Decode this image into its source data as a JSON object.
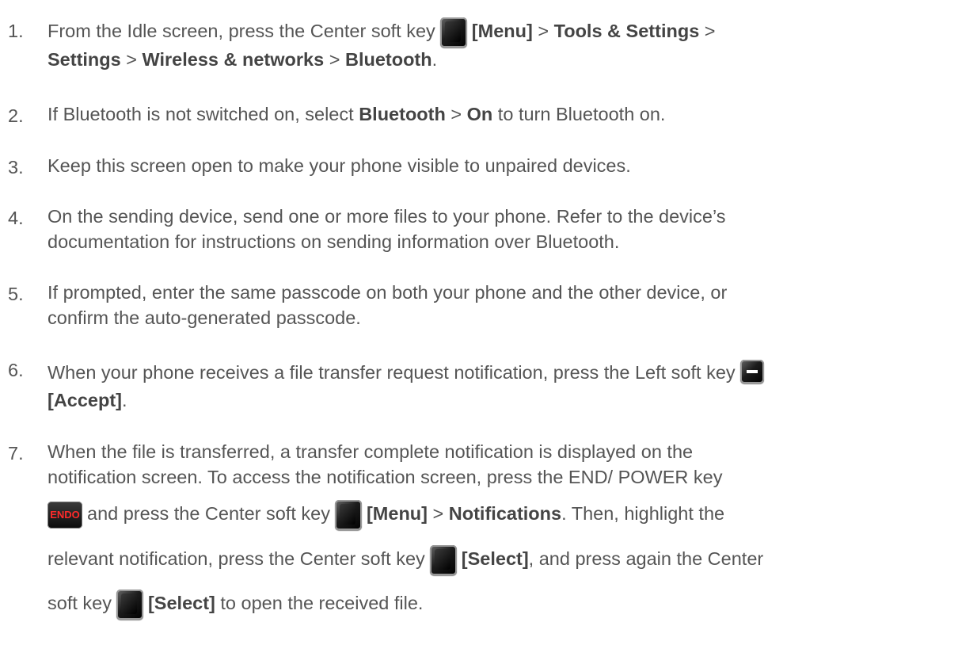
{
  "steps": [
    {
      "num": "1.",
      "lines": [
        {
          "pre": "From the Idle screen, press the Center soft key",
          "b1": "[Menu]",
          "s1": " > ",
          "b2": "Tools & Settings",
          "s2": " >"
        },
        {
          "b1": "Settings",
          "s1": " > ",
          "b2": "Wireless & networks",
          "s2": " > ",
          "b3": "Bluetooth",
          "post": "."
        }
      ]
    },
    {
      "num": "2.",
      "lines": [
        {
          "pre": "If Bluetooth is not switched on, select ",
          "b1": "Bluetooth",
          "s1": " > ",
          "b2": "On",
          "post": " to turn Bluetooth on."
        }
      ]
    },
    {
      "num": "3.",
      "lines": [
        {
          "text": "Keep this screen open to make your phone visible to unpaired devices."
        }
      ]
    },
    {
      "num": "4.",
      "lines": [
        {
          "text": "On the sending device, send one or more files to your phone. Refer to the device’s"
        },
        {
          "text": "documentation for instructions on sending information over Bluetooth."
        }
      ]
    },
    {
      "num": "5.",
      "lines": [
        {
          "text": "If prompted, enter the same passcode on both your phone and the other device, or"
        },
        {
          "text": "confirm the auto-generated passcode."
        }
      ]
    },
    {
      "num": "6.",
      "lines": [
        {
          "text": "When your phone receives a file transfer request notification, press the Left soft key"
        },
        {
          "b1": "[Accept]",
          "post": "."
        }
      ]
    },
    {
      "num": "7.",
      "lines": [
        {
          "text": "When the file is transferred, a transfer complete notification is displayed on the"
        },
        {
          "text": "notification screen. To access the notification screen, press the END/ POWER key"
        },
        {
          "pre": "and press the Center soft key",
          "b1": "[Menu]",
          "s1": " > ",
          "b2": "Notifications",
          "post": ". Then, highlight the"
        },
        {
          "pre": "relevant notification, press the Center soft key",
          "b1": "[Select]",
          "post": ", and press again the Center"
        },
        {
          "pre": "soft key",
          "b1": "[Select]",
          "post": " to open the received file."
        }
      ]
    }
  ],
  "icons": {
    "center_soft_key": "center-soft-key-icon",
    "left_soft_key": "left-soft-key-icon",
    "end_power_key": "end-power-key-icon",
    "end_key_label": "ENDO"
  }
}
